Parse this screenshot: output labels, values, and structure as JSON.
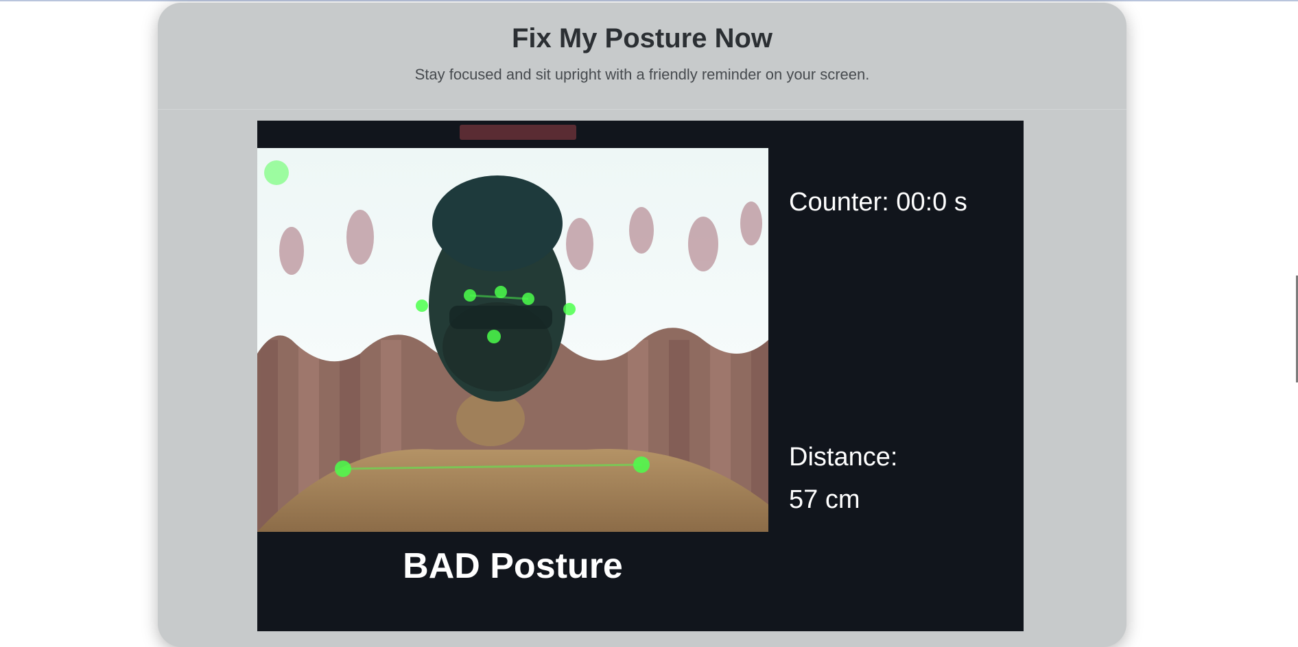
{
  "header": {
    "title": "Fix My Posture Now",
    "subtitle": "Stay focused and sit upright with a friendly reminder on your screen."
  },
  "monitor": {
    "duration_text": "Counter: 00:0 s",
    "distance_label": "Distance:",
    "distance_value": "57 cm",
    "posture_status": "BAD Posture"
  },
  "colors": {
    "page_bg": "#ffffff",
    "card_bg": "#c7cacb",
    "stage_bg": "#11151c",
    "landmark": "#4cff4c",
    "tab_accent": "#5a2c33"
  },
  "icons": {
    "landmarks": "pose-landmark-dots"
  }
}
